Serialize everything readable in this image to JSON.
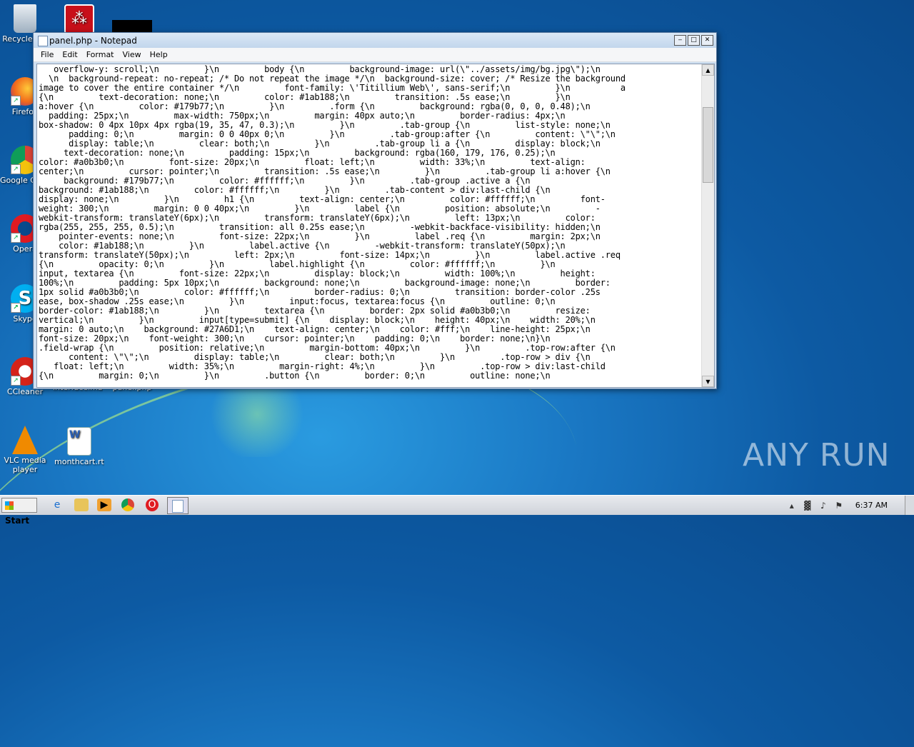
{
  "desktop": {
    "icons": [
      {
        "label": "Recycle Bin",
        "icon": "recycle-bin-icon"
      },
      {
        "label": "Firefox",
        "icon": "firefox-icon"
      },
      {
        "label": "Google Chrome",
        "icon": "chrome-icon"
      },
      {
        "label": "Opera",
        "icon": "opera-icon"
      },
      {
        "label": "Skype",
        "icon": "skype-icon"
      },
      {
        "label": "CCleaner",
        "icon": "ccleaner-icon"
      },
      {
        "label": "VLC media player",
        "icon": "vlc-icon"
      },
      {
        "label": "interfaceima...",
        "icon": "file-icon"
      },
      {
        "label": "panel.php",
        "icon": "file-icon"
      },
      {
        "label": "monthcart.rtf",
        "icon": "word-document-icon"
      }
    ],
    "watermark": "ANY RUN"
  },
  "notepad": {
    "title": "panel.php - Notepad",
    "menu": [
      "File",
      "Edit",
      "Format",
      "View",
      "Help"
    ],
    "lines": [
      "   overflow-y: scroll;\\n         }\\n         body {\\n         background-image: url(\\\"../assets/img/bg.jpg\\\");\\n",
      "  \\n  background-repeat: no-repeat; /* Do not repeat the image */\\n  background-size: cover; /* Resize the background",
      "image to cover the entire container */\\n         font-family: \\'Titillium Web\\', sans-serif;\\n         }\\n          a",
      "{\\n         text-decoration: none;\\n         color: #1ab188;\\n         transition: .5s ease;\\n         }\\n",
      "a:hover {\\n         color: #179b77;\\n         }\\n         .form {\\n         background: rgba(0, 0, 0, 0.48);\\n",
      "  padding: 25px;\\n         max-width: 750px;\\n         margin: 40px auto;\\n         border-radius: 4px;\\n",
      "box-shadow: 0 4px 10px 4px rgba(19, 35, 47, 0.3);\\n         }\\n         .tab-group {\\n         list-style: none;\\n",
      "      padding: 0;\\n         margin: 0 0 40px 0;\\n         }\\n         .tab-group:after {\\n         content: \\\"\\\";\\n",
      "      display: table;\\n         clear: both;\\n         }\\n         .tab-group li a {\\n         display: block;\\n",
      "     text-decoration: none;\\n         padding: 15px;\\n         background: rgba(160, 179, 176, 0.25);\\n",
      "color: #a0b3b0;\\n         font-size: 20px;\\n         float: left;\\n         width: 33%;\\n         text-align:",
      "center;\\n         cursor: pointer;\\n         transition: .5s ease;\\n         }\\n         .tab-group li a:hover {\\n",
      "     background: #179b77;\\n         color: #ffffff;\\n         }\\n         .tab-group .active a {\\n",
      "background: #1ab188;\\n         color: #ffffff;\\n         }\\n         .tab-content > div:last-child {\\n",
      "display: none;\\n         }\\n         h1 {\\n         text-align: center;\\n         color: #ffffff;\\n         font-",
      "weight: 300;\\n         margin: 0 0 40px;\\n         }\\n         label {\\n         position: absolute;\\n         -",
      "webkit-transform: translateY(6px);\\n         transform: translateY(6px);\\n         left: 13px;\\n         color:",
      "rgba(255, 255, 255, 0.5);\\n         transition: all 0.25s ease;\\n         -webkit-backface-visibility: hidden;\\n",
      "    pointer-events: none;\\n         font-size: 22px;\\n         }\\n         label .req {\\n         margin: 2px;\\n",
      "    color: #1ab188;\\n         }\\n         label.active {\\n         -webkit-transform: translateY(50px);\\n",
      "transform: translateY(50px);\\n         left: 2px;\\n         font-size: 14px;\\n         }\\n         label.active .req",
      "{\\n         opacity: 0;\\n         }\\n         label.highlight {\\n         color: #ffffff;\\n         }\\n",
      "input, textarea {\\n         font-size: 22px;\\n         display: block;\\n         width: 100%;\\n         height:",
      "100%;\\n         padding: 5px 10px;\\n         background: none;\\n         background-image: none;\\n         border:",
      "1px solid #a0b3b0;\\n         color: #ffffff;\\n         border-radius: 0;\\n         transition: border-color .25s",
      "ease, box-shadow .25s ease;\\n         }\\n         input:focus, textarea:focus {\\n         outline: 0;\\n",
      "border-color: #1ab188;\\n         }\\n         textarea {\\n         border: 2px solid #a0b3b0;\\n         resize:",
      "vertical;\\n         }\\n         input[type=submit] {\\n    display: block;\\n    height: 40px;\\n    width: 20%;\\n",
      "margin: 0 auto;\\n    background: #27A6D1;\\n    text-align: center;\\n    color: #fff;\\n    line-height: 25px;\\n",
      "font-size: 20px;\\n    font-weight: 300;\\n    cursor: pointer;\\n    padding: 0;\\n    border: none;\\n}\\n",
      ".field-wrap {\\n         position: relative;\\n         margin-bottom: 40px;\\n         }\\n         .top-row:after {\\n",
      "      content: \\\"\\\";\\n         display: table;\\n         clear: both;\\n         }\\n         .top-row > div {\\n",
      "   float: left;\\n         width: 35%;\\n         margin-right: 4%;\\n         }\\n         .top-row > div:last-child",
      "{\\n         margin: 0;\\n         }\\n         .button {\\n         border: 0;\\n         outline: none;\\n"
    ]
  },
  "taskbar": {
    "start_label": "Start",
    "clock": "6:37 AM",
    "pinned": [
      "ie-icon",
      "explorer-icon",
      "media-player-icon",
      "chrome-icon",
      "opera-icon",
      "notepad-icon"
    ]
  }
}
